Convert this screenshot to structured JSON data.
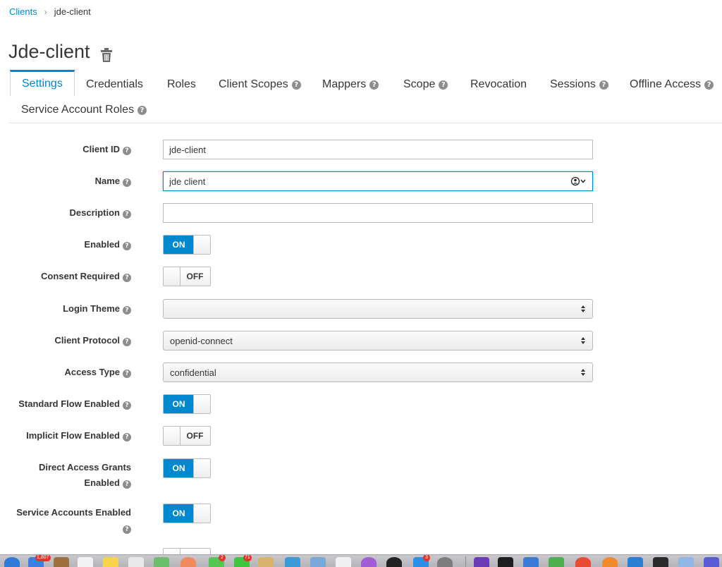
{
  "breadcrumb": {
    "parent": "Clients",
    "separator": "›",
    "current": "jde-client"
  },
  "page": {
    "title": "Jde-client"
  },
  "tabs": [
    {
      "label": "Settings",
      "help": false
    },
    {
      "label": "Credentials",
      "help": false
    },
    {
      "label": "Roles",
      "help": false
    },
    {
      "label": "Client Scopes",
      "help": true
    },
    {
      "label": "Mappers",
      "help": true
    },
    {
      "label": "Scope",
      "help": true
    },
    {
      "label": "Revocation",
      "help": false
    },
    {
      "label": "Sessions",
      "help": true
    },
    {
      "label": "Offline Access",
      "help": true
    },
    {
      "label": "Service Account Roles",
      "help": true
    }
  ],
  "help_glyph": "?",
  "form": {
    "client_id": {
      "label": "Client ID",
      "value": "jde-client"
    },
    "name": {
      "label": "Name",
      "value": "jde client"
    },
    "description": {
      "label": "Description",
      "value": ""
    },
    "enabled": {
      "label": "Enabled",
      "state": "ON"
    },
    "consent_required": {
      "label": "Consent Required",
      "state": "OFF"
    },
    "login_theme": {
      "label": "Login Theme",
      "value": ""
    },
    "client_protocol": {
      "label": "Client Protocol",
      "value": "openid-connect"
    },
    "access_type": {
      "label": "Access Type",
      "value": "confidential"
    },
    "standard_flow": {
      "label": "Standard Flow Enabled",
      "state": "ON"
    },
    "implicit_flow": {
      "label": "Implicit Flow Enabled",
      "state": "OFF"
    },
    "direct_access": {
      "label_line1": "Direct Access Grants",
      "label_line2": "Enabled",
      "state": "ON"
    },
    "service_accounts": {
      "label": "Service Accounts Enabled",
      "state": "ON"
    }
  },
  "dock": {
    "badges": [
      "1,807",
      "2",
      "71",
      "3"
    ]
  },
  "colors": {
    "accent": "#0088ce",
    "text": "#363636",
    "help": "#8b8d8f"
  }
}
